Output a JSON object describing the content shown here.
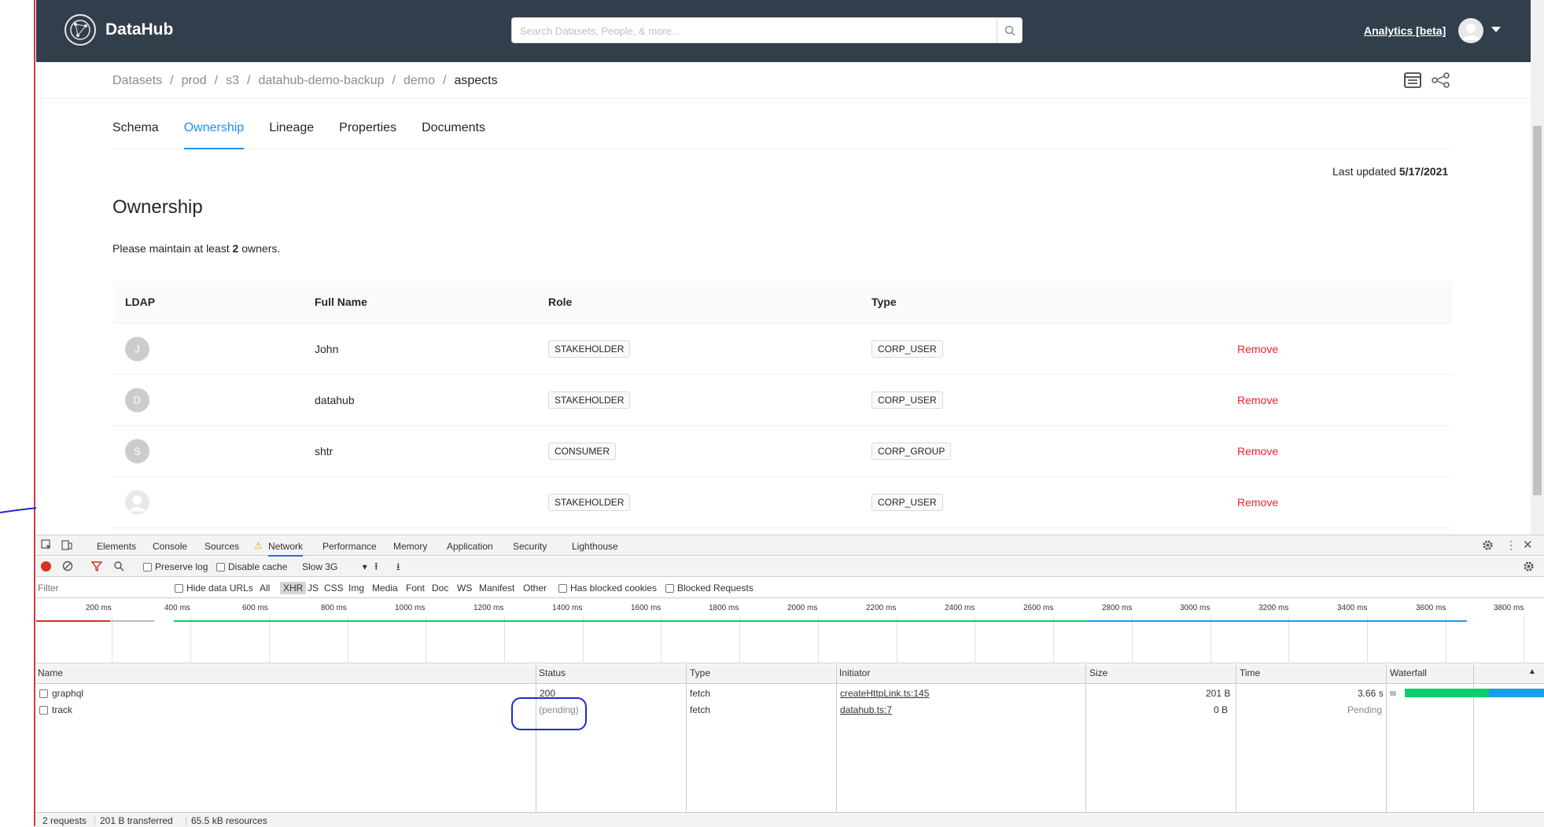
{
  "header": {
    "brand": "DataHub",
    "search_placeholder": "Search Datasets, People, & more...",
    "analytics_link": "Analytics [beta]"
  },
  "breadcrumb": [
    "Datasets",
    "prod",
    "s3",
    "datahub-demo-backup",
    "demo",
    "aspects"
  ],
  "tabs": [
    "Schema",
    "Ownership",
    "Lineage",
    "Properties",
    "Documents"
  ],
  "active_tab": "Ownership",
  "last_updated": {
    "label": "Last updated",
    "date": "5/17/2021"
  },
  "ownership": {
    "title": "Ownership",
    "note_prefix": "Please maintain at least",
    "note_count": "2",
    "note_suffix": "owners.",
    "columns": [
      "LDAP",
      "Full Name",
      "Role",
      "Type"
    ],
    "rows": [
      {
        "initial": "J",
        "name": "John",
        "role": "STAKEHOLDER",
        "type": "CORP_USER",
        "action": "Remove"
      },
      {
        "initial": "D",
        "name": "datahub",
        "role": "STAKEHOLDER",
        "type": "CORP_USER",
        "action": "Remove"
      },
      {
        "initial": "S",
        "name": "shtr",
        "role": "CONSUMER",
        "type": "CORP_GROUP",
        "action": "Remove"
      },
      {
        "initial": "",
        "name": "",
        "role": "STAKEHOLDER",
        "type": "CORP_USER",
        "action": "Remove"
      }
    ]
  },
  "devtools": {
    "tabs": [
      "Elements",
      "Console",
      "Sources",
      "Network",
      "Performance",
      "Memory",
      "Application",
      "Security",
      "Lighthouse"
    ],
    "active_tab": "Network",
    "preserve_log": "Preserve log",
    "disable_cache": "Disable cache",
    "throttle": "Slow 3G",
    "filter_placeholder": "Filter",
    "hide_data_urls": "Hide data URLs",
    "type_filters": [
      "All",
      "XHR",
      "JS",
      "CSS",
      "Img",
      "Media",
      "Font",
      "Doc",
      "WS",
      "Manifest",
      "Other"
    ],
    "has_blocked_cookies": "Has blocked cookies",
    "blocked_requests": "Blocked Requests",
    "timeline_ticks": [
      "200 ms",
      "400 ms",
      "600 ms",
      "800 ms",
      "1000 ms",
      "1200 ms",
      "1400 ms",
      "1600 ms",
      "1800 ms",
      "2000 ms",
      "2200 ms",
      "2400 ms",
      "2600 ms",
      "2800 ms",
      "3000 ms",
      "3200 ms",
      "3400 ms",
      "3600 ms",
      "3800 ms"
    ],
    "columns": [
      "Name",
      "Status",
      "Type",
      "Initiator",
      "Size",
      "Time",
      "Waterfall"
    ],
    "requests": [
      {
        "name": "graphql",
        "status": "200",
        "type": "fetch",
        "initiator": "createHttpLink.ts:145",
        "size": "201 B",
        "time": "3.66 s"
      },
      {
        "name": "track",
        "status": "(pending)",
        "type": "fetch",
        "initiator": "datahub.ts:7",
        "size": "0 B",
        "time": "Pending"
      }
    ],
    "summary": [
      "2 requests",
      "201 B transferred",
      "65.5 kB resources"
    ]
  }
}
